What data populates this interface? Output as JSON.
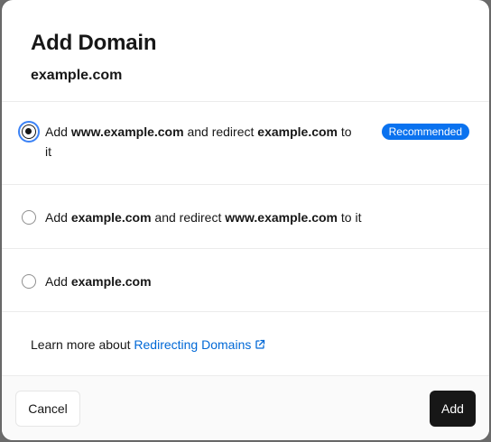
{
  "modal": {
    "title": "Add Domain",
    "domain": "example.com"
  },
  "options": [
    {
      "prefix": "Add ",
      "bold1": "www.example.com",
      "middle": " and redirect ",
      "bold2": "example.com",
      "suffix": " to it",
      "selected": true,
      "badge": "Recommended"
    },
    {
      "prefix": "Add ",
      "bold1": "example.com",
      "middle": " and redirect ",
      "bold2": "www.example.com",
      "suffix": " to it",
      "selected": false
    },
    {
      "prefix": "Add ",
      "bold1": "example.com",
      "selected": false
    }
  ],
  "learn_more": {
    "text": "Learn more about ",
    "link": "Redirecting Domains",
    "icon": "external-link-icon"
  },
  "footer": {
    "cancel_label": "Cancel",
    "add_label": "Add"
  },
  "colors": {
    "accent": "#0a72ef",
    "link": "#0068d6",
    "primary_button": "#171717",
    "focus_ring": "#3b82f6"
  }
}
